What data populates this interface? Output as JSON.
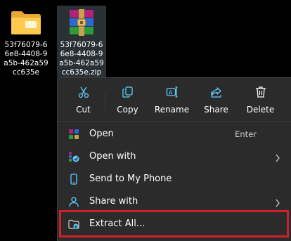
{
  "desktop": {
    "folder_label": "53f76079-66e8-4408-9a5b-462a59cc635e",
    "zip_label": "53f76079-66e8-4408-9a5b-462a59cc635e.zip"
  },
  "menu": {
    "actions": [
      {
        "label": "Cut"
      },
      {
        "label": "Copy"
      },
      {
        "label": "Rename"
      },
      {
        "label": "Share"
      },
      {
        "label": "Delete"
      }
    ],
    "items": [
      {
        "label": "Open",
        "shortcut": "Enter"
      },
      {
        "label": "Open with"
      },
      {
        "label": "Send to My Phone"
      },
      {
        "label": "Share with"
      },
      {
        "label": "Extract All..."
      }
    ]
  },
  "colors": {
    "highlight_border": "#d11f2b",
    "menu_bg": "#2b2b2b",
    "accent_icon": "#60cdff"
  }
}
